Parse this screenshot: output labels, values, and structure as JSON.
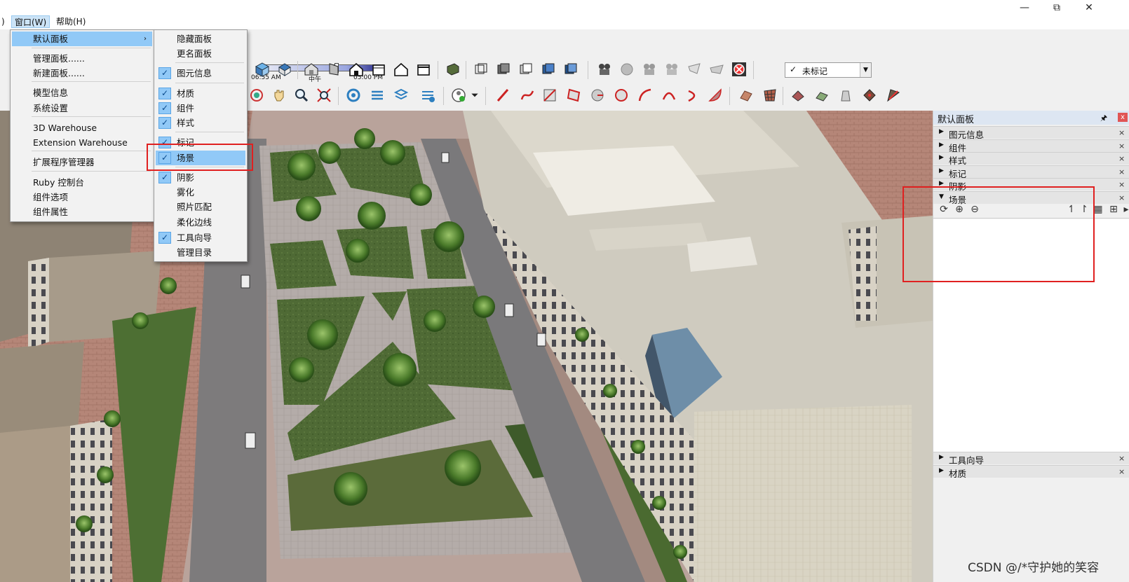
{
  "menubar": {
    "prev_fragment": ")",
    "window_menu": "窗口(W)",
    "help_menu": "帮助(H)"
  },
  "window_controls": {
    "minimize": "—",
    "restore": "⧉",
    "close": "✕"
  },
  "time_slider": {
    "start": "06:55 AM",
    "noon": "中午",
    "end": "05:00 PM",
    "position": 0.62
  },
  "tag_dropdown": {
    "value": "未标记"
  },
  "window_menu_items": [
    {
      "label": "默认面板",
      "submenu": true,
      "highlighted": true
    },
    {
      "label": "管理面板......"
    },
    {
      "label": "新建面板......"
    },
    {
      "label": "模型信息"
    },
    {
      "label": "系统设置"
    },
    {
      "label": "3D Warehouse"
    },
    {
      "label": "Extension Warehouse"
    },
    {
      "label": "扩展程序管理器"
    },
    {
      "label": "Ruby 控制台"
    },
    {
      "label": "组件选项"
    },
    {
      "label": "组件属性"
    }
  ],
  "default_tray_submenu": [
    {
      "label": "隐藏面板",
      "checked": false
    },
    {
      "label": "更名面板",
      "checked": false
    },
    {
      "label": "图元信息",
      "checked": true
    },
    {
      "label": "材质",
      "checked": true
    },
    {
      "label": "组件",
      "checked": true
    },
    {
      "label": "样式",
      "checked": true
    },
    {
      "label": "标记",
      "checked": true
    },
    {
      "label": "场景",
      "checked": true,
      "highlighted": true
    },
    {
      "label": "阴影",
      "checked": true
    },
    {
      "label": "雾化",
      "checked": false
    },
    {
      "label": "照片匹配",
      "checked": false
    },
    {
      "label": "柔化边线",
      "checked": false
    },
    {
      "label": "工具向导",
      "checked": true
    },
    {
      "label": "管理目录",
      "checked": false
    }
  ],
  "tray": {
    "title": "默认面板",
    "pin": "🖈",
    "close": "x",
    "sections_top": [
      {
        "label": "图元信息",
        "expanded": false
      },
      {
        "label": "组件",
        "expanded": false
      },
      {
        "label": "样式",
        "expanded": false
      },
      {
        "label": "标记",
        "expanded": false
      },
      {
        "label": "阴影",
        "expanded": false
      },
      {
        "label": "场景",
        "expanded": true
      }
    ],
    "sections_bottom": [
      {
        "label": "工具向导",
        "expanded": false
      },
      {
        "label": "材质",
        "expanded": false
      }
    ]
  },
  "colors": {
    "menu_highlight": "#91c9f7",
    "red_box": "#e02020",
    "tray_header": "#dde6f2"
  },
  "watermark": "CSDN @/*守护她的笑容"
}
